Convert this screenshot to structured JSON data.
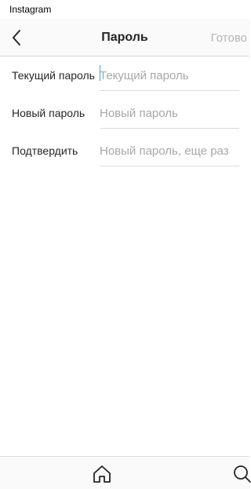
{
  "window": {
    "title": "Instagram"
  },
  "header": {
    "back_icon": "back-arrow-icon",
    "title": "Пароль",
    "done_label": "Готово"
  },
  "form": {
    "current_password": {
      "label": "Текущий пароль",
      "placeholder": "Текущий пароль",
      "value": ""
    },
    "new_password": {
      "label": "Новый пароль",
      "placeholder": "Новый пароль",
      "value": ""
    },
    "confirm_password": {
      "label": "Подтвердить",
      "placeholder": "Новый пароль, еще раз",
      "value": ""
    }
  },
  "bottom_nav": {
    "home_icon": "home-icon",
    "search_icon": "search-icon"
  },
  "colors": {
    "accent": "#4a9ed8",
    "placeholder": "#a8a8a8",
    "disabled_text": "#b5b5b5",
    "divider": "#dbdbdb"
  }
}
